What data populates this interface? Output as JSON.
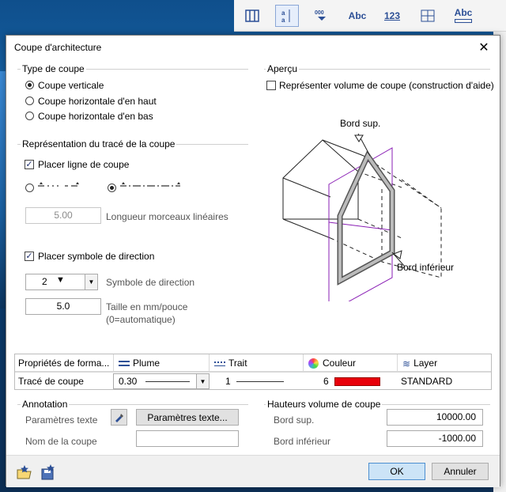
{
  "bg_toolbar": {
    "tool3_label": "Abc",
    "tool4_label": "123",
    "tool6_label": "Abc"
  },
  "dialog": {
    "title": "Coupe d'architecture"
  },
  "type_coupe": {
    "title": "Type de coupe",
    "options": [
      "Coupe verticale",
      "Coupe horizontale d'en haut",
      "Coupe horizontale d'en bas"
    ],
    "selected_index": 0
  },
  "representation": {
    "title": "Représentation du tracé de la coupe",
    "placer_ligne": "Placer ligne de coupe",
    "placer_ligne_checked": true,
    "longueur_value": "5.00",
    "longueur_label": "Longueur morceaux linéaires",
    "placer_symbole": "Placer symbole de direction",
    "placer_symbole_checked": true,
    "symbole_value": "2",
    "symbole_label": "Symbole de direction",
    "taille_value": "5.0",
    "taille_label_1": "Taille en mm/pouce",
    "taille_label_2": "(0=automatique)"
  },
  "apercu": {
    "title": "Aperçu",
    "checkbox_label": "Représenter volume de coupe (construction d'aide)",
    "checkbox_checked": false,
    "label_top": "Bord sup.",
    "label_bottom": "Bord inférieur"
  },
  "properties": {
    "headers": [
      "Propriétés de forma...",
      "Plume",
      "Trait",
      "Couleur",
      "Layer"
    ],
    "row_label": "Tracé de coupe",
    "plume": "0.30",
    "trait": "1",
    "couleur": "6",
    "couleur_hex": "#e8000a",
    "layer": "STANDARD"
  },
  "annotation": {
    "title": "Annotation",
    "params_label": "Paramètres texte",
    "params_button": "Paramètres texte...",
    "nom_label": "Nom de la coupe",
    "nom_value": ""
  },
  "hauteurs": {
    "title": "Hauteurs volume de coupe",
    "sup_label": "Bord sup.",
    "sup_value": "10000.00",
    "inf_label": "Bord inférieur",
    "inf_value": "-1000.00"
  },
  "footer": {
    "ok": "OK",
    "cancel": "Annuler"
  },
  "colors": {
    "accent": "#4d8fd0",
    "preview_purple": "#8a1fb5"
  }
}
